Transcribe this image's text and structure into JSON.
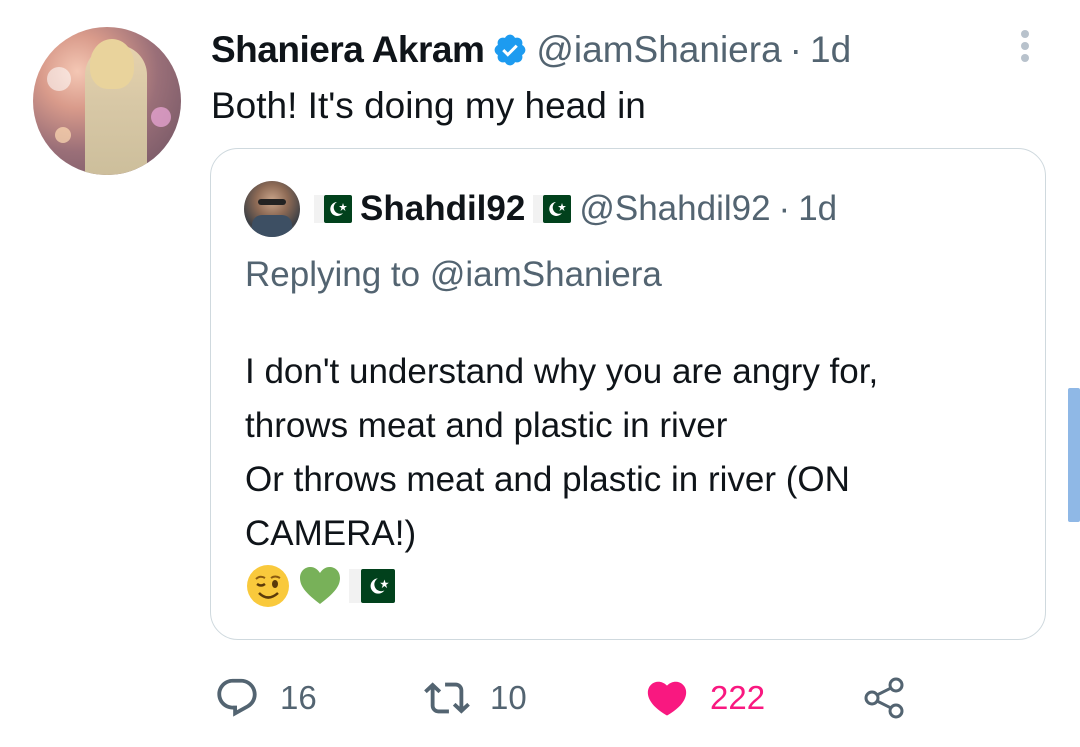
{
  "tweet": {
    "author_name": "Shaniera Akram",
    "author_handle": "@iamShaniera",
    "separator": "·",
    "time": "1d",
    "text": "Both! It's doing my head in"
  },
  "quoted": {
    "author_name": "Shahdil92",
    "author_handle": "@Shahdil92",
    "separator": "·",
    "time": "1d",
    "replying_to": "Replying to @iamShaniera",
    "lines": [
      "I don't understand why you are angry for,",
      "throws meat and plastic in river",
      "Or throws meat and plastic in river (ON",
      "CAMERA!)"
    ],
    "emojis": [
      "winking-face",
      "green-heart",
      "pakistan-flag"
    ]
  },
  "actions": {
    "replies": "16",
    "retweets": "10",
    "likes": "222"
  },
  "colors": {
    "text": "#0f1419",
    "muted": "#536471",
    "verified": "#1d9bf0",
    "like": "#f91880",
    "border": "#cfd9de"
  }
}
